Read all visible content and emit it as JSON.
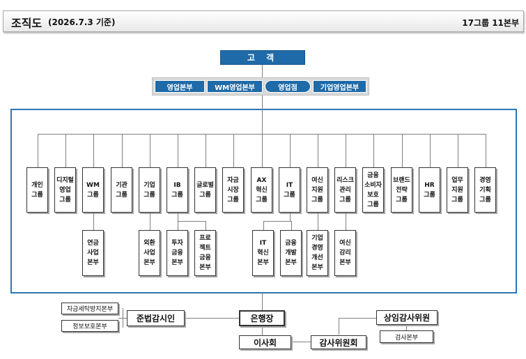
{
  "header": {
    "title": "조직도",
    "subtitle": "(2026.7.3 기준)",
    "group_count": "17그룹 11본부"
  },
  "customer": "고 객",
  "channels": [
    "영업본부",
    "WM영업본부",
    "영업점",
    "기업영업본부"
  ],
  "groups": [
    {
      "label": "개인\n그룹"
    },
    {
      "label": "디지털\n영업\n그룹"
    },
    {
      "label": "WM\n그룹",
      "subs": [
        "연금\n사업\n본부"
      ]
    },
    {
      "label": "기관\n그룹"
    },
    {
      "label": "기업\n그룹",
      "subs": [
        "외환\n사업\n본부"
      ]
    },
    {
      "label": "IB\n그룹",
      "subs": [
        "투자\n금융\n본부",
        "프로\n젝트\n금융\n본부"
      ]
    },
    {
      "label": "글로벌\n그룹"
    },
    {
      "label": "자금\n시장\n그룹"
    },
    {
      "label": "AX\n혁신\n그룹"
    },
    {
      "label": "IT\n그룹",
      "subs": [
        "IT\n혁신\n본부",
        "금융\n개발\n본부"
      ]
    },
    {
      "label": "여신\n지원\n그룹",
      "subs": [
        "기업\n경영\n개선\n본부"
      ]
    },
    {
      "label": "리스크\n관리\n그룹",
      "subs": [
        "여신\n감리\n본부"
      ]
    },
    {
      "label": "금융\n소비자\n보호\n그룹"
    },
    {
      "label": "브랜드\n전략\n그룹"
    },
    {
      "label": "HR\n그룹"
    },
    {
      "label": "업무\n지원\n그룹"
    },
    {
      "label": "경영\n기획\n그룹"
    }
  ],
  "governance": {
    "ceo": "은행장",
    "board": "이사회",
    "audit_committee": "감사위원회",
    "standing_auditor": "상임감사위원",
    "audit_division": "검사본부",
    "compliance_officer": "준법감시인",
    "aml_division": "자금세탁방지본부",
    "info_protection_division": "정보보호본부"
  }
}
